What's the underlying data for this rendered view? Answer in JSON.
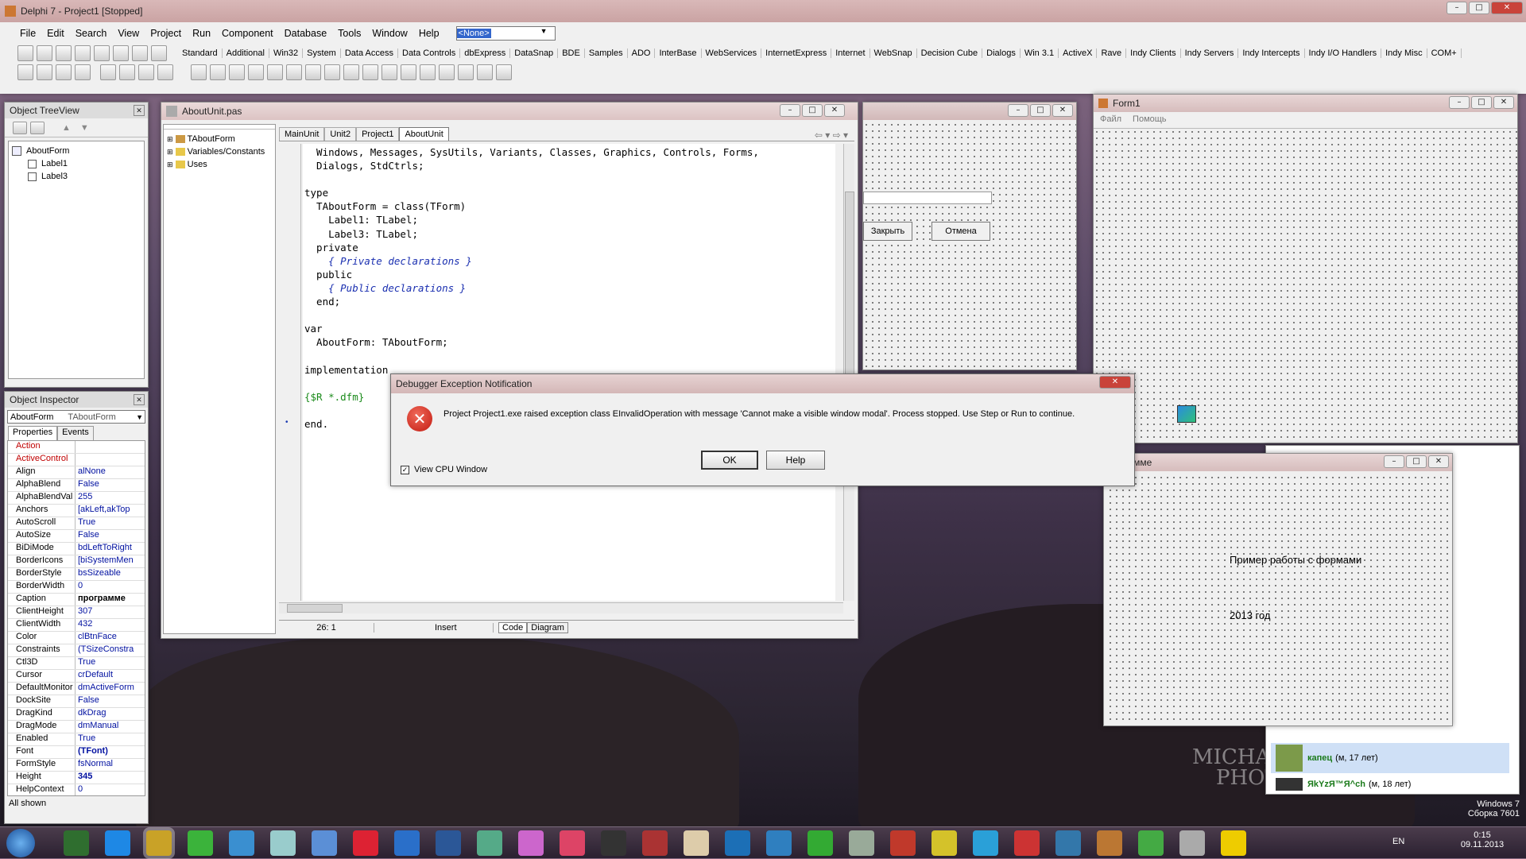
{
  "ide": {
    "title": "Delphi 7 - Project1 [Stopped]",
    "menu": [
      "File",
      "Edit",
      "Search",
      "View",
      "Project",
      "Run",
      "Component",
      "Database",
      "Tools",
      "Window",
      "Help"
    ],
    "combo": "<None>",
    "palette_tabs": [
      "Standard",
      "Additional",
      "Win32",
      "System",
      "Data Access",
      "Data Controls",
      "dbExpress",
      "DataSnap",
      "BDE",
      "Samples",
      "ADO",
      "InterBase",
      "WebServices",
      "InternetExpress",
      "Internet",
      "WebSnap",
      "Decision Cube",
      "Dialogs",
      "Win 3.1",
      "ActiveX",
      "Rave",
      "Indy Clients",
      "Indy Servers",
      "Indy Intercepts",
      "Indy I/O Handlers",
      "Indy Misc",
      "COM+"
    ]
  },
  "treeview": {
    "title": "Object TreeView",
    "root": "AboutForm",
    "children": [
      "Label1",
      "Label3"
    ]
  },
  "inspector": {
    "title": "Object Inspector",
    "object": "AboutForm",
    "type": "TAboutForm",
    "tabs": [
      "Properties",
      "Events"
    ],
    "footer": "All shown",
    "rows": [
      [
        "Action",
        ""
      ],
      [
        "ActiveControl",
        ""
      ],
      [
        "Align",
        "alNone"
      ],
      [
        "AlphaBlend",
        "False"
      ],
      [
        "AlphaBlendVal",
        "255"
      ],
      [
        "Anchors",
        "[akLeft,akTop"
      ],
      [
        "AutoScroll",
        "True"
      ],
      [
        "AutoSize",
        "False"
      ],
      [
        "BiDiMode",
        "bdLeftToRight"
      ],
      [
        "BorderIcons",
        "[biSystemMen"
      ],
      [
        "BorderStyle",
        "bsSizeable"
      ],
      [
        "BorderWidth",
        "0"
      ],
      [
        "Caption",
        "программе"
      ],
      [
        "ClientHeight",
        "307"
      ],
      [
        "ClientWidth",
        "432"
      ],
      [
        "Color",
        "clBtnFace"
      ],
      [
        "Constraints",
        "(TSizeConstra"
      ],
      [
        "Ctl3D",
        "True"
      ],
      [
        "Cursor",
        "crDefault"
      ],
      [
        "DefaultMonitor",
        "dmActiveForm"
      ],
      [
        "DockSite",
        "False"
      ],
      [
        "DragKind",
        "dkDrag"
      ],
      [
        "DragMode",
        "dmManual"
      ],
      [
        "Enabled",
        "True"
      ],
      [
        "Font",
        "(TFont)"
      ],
      [
        "FormStyle",
        "fsNormal"
      ],
      [
        "Height",
        "345"
      ],
      [
        "HelpContext",
        "0"
      ]
    ]
  },
  "editor": {
    "title": "AboutUnit.pas",
    "tabs": [
      "MainUnit",
      "Unit2",
      "Project1",
      "AboutUnit"
    ],
    "explorer": [
      "TAboutForm",
      "Variables/Constants",
      "Uses"
    ],
    "code": [
      "  Windows, Messages, SysUtils, Variants, Classes, Graphics, Controls, Forms,",
      "  Dialogs, StdCtrls;",
      "",
      "type",
      "  TAboutForm = class(TForm)",
      "    Label1: TLabel;",
      "    Label3: TLabel;",
      "  private",
      "    { Private declarations }",
      "  public",
      "    { Public declarations }",
      "  end;",
      "",
      "var",
      "  AboutForm: TAboutForm;",
      "",
      "implementation",
      "",
      "{$R *.dfm}",
      "",
      "end."
    ],
    "status": {
      "pos": "26:  1",
      "mode": "Insert",
      "tabs": [
        "Code",
        "Diagram"
      ]
    }
  },
  "dialog": {
    "title": "Debugger Exception Notification",
    "message": "Project Project1.exe raised exception class EInvalidOperation with message 'Cannot make a visible window modal'. Process stopped. Use Step or Run to continue.",
    "ok": "OK",
    "help": "Help",
    "checkbox": "View CPU Window"
  },
  "form2": {
    "btn1": "Закрыть",
    "btn2": "Отмена"
  },
  "form1": {
    "title": "Form1",
    "menu": [
      "Файл",
      "Помощь"
    ]
  },
  "about": {
    "title": "рограмме",
    "label1": "Пример работы с формами",
    "label2": "2013 год"
  },
  "chat": {
    "users": [
      {
        "name": "капец",
        "info": "(м, 17 лет)"
      },
      {
        "name": "ЯkYzЯ™Я^ch",
        "info": "(м, 18 лет)"
      }
    ]
  },
  "watermark": [
    "MICHAE",
    "PHOT"
  ],
  "taskbar": {
    "lang": "EN",
    "time": "0:15",
    "date": "09.11.2013",
    "os": [
      "Windows 7",
      "Сборка 7601"
    ]
  }
}
